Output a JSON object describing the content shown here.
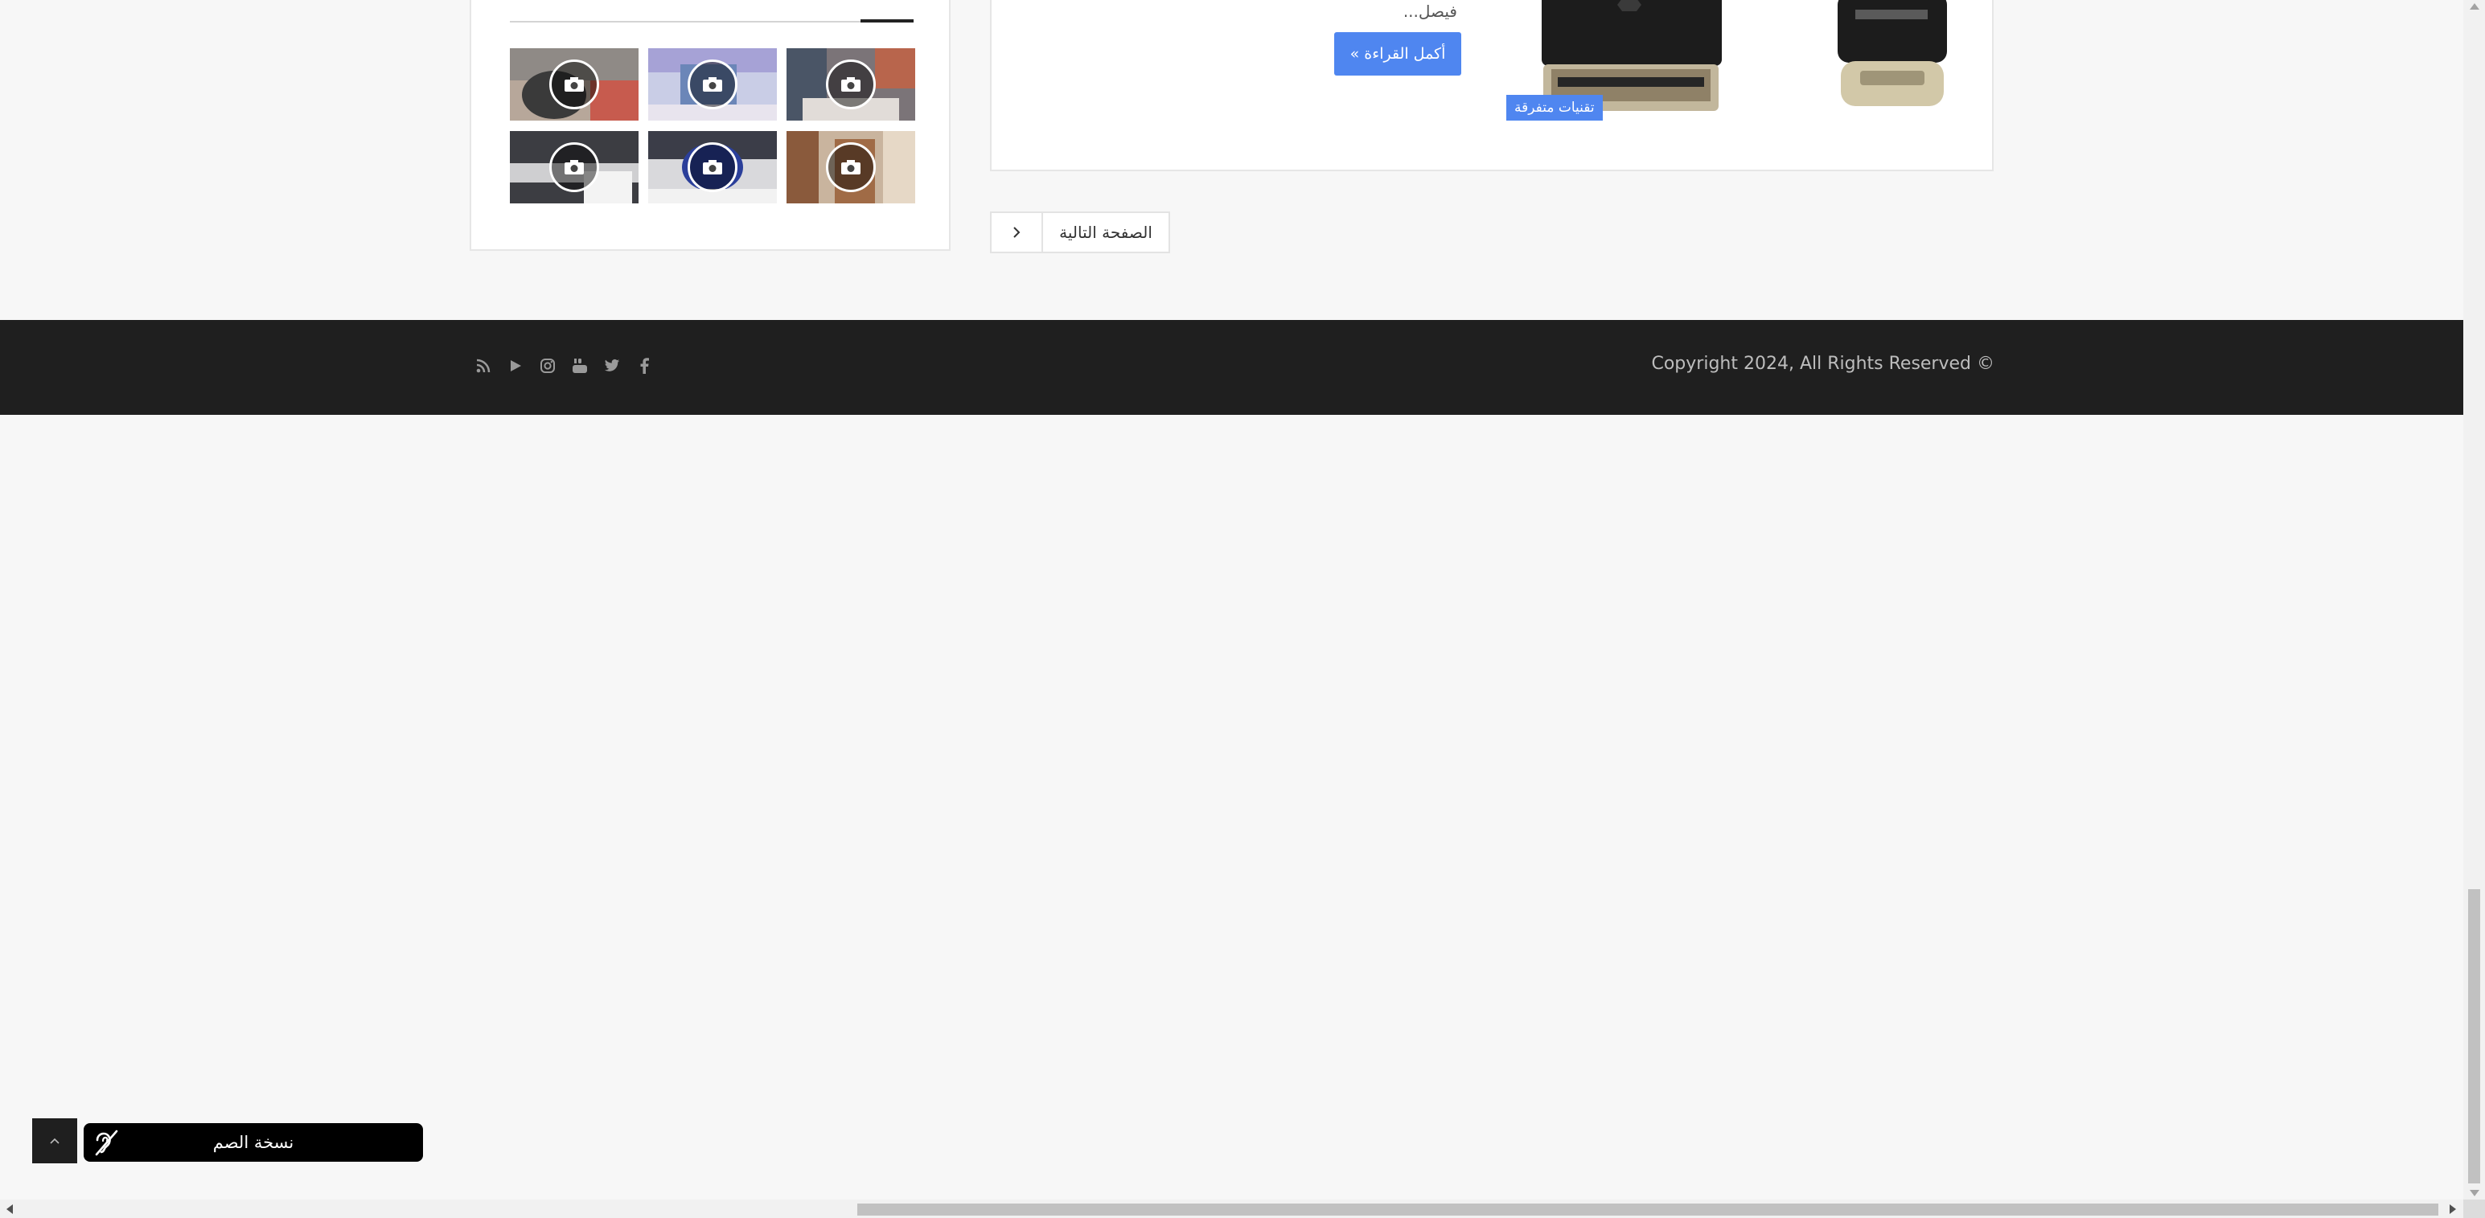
{
  "sidebar": {
    "gallery": [
      {
        "icon": "camera-icon",
        "bg": "#8a7f77"
      },
      {
        "icon": "camera-icon",
        "bg": "#9aa6c9"
      },
      {
        "icon": "camera-icon",
        "bg": "#6d6a70"
      },
      {
        "icon": "camera-icon",
        "bg": "#3b3d44"
      },
      {
        "icon": "camera-icon",
        "bg": "#5a5e6e"
      },
      {
        "icon": "camera-icon",
        "bg": "#8b6a4e"
      }
    ]
  },
  "article": {
    "excerpt": "فيصل...",
    "read_more_label": "أكمل القراءة »",
    "category_label": "تقنيات متفرقة",
    "accent_color": "#4f86f0"
  },
  "pagination": {
    "next_label": "الصفحة التالية",
    "arrow_icon": "chevron-right-icon"
  },
  "footer": {
    "copyright": "Copyright 2024, All Rights Reserved ©",
    "social_icons": [
      "facebook-icon",
      "twitter-icon",
      "youtube-icon",
      "instagram-icon",
      "play-icon",
      "rss-icon"
    ]
  },
  "floating": {
    "back_to_top_icon": "chevron-up-icon",
    "deaf_version_label": "نسخة الصم",
    "deaf_icon": "hearing-impaired-icon"
  }
}
